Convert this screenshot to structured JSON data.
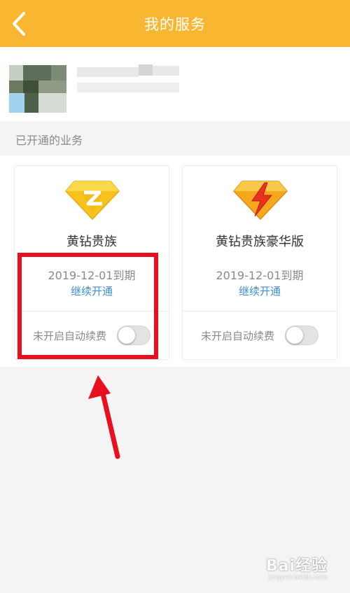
{
  "header": {
    "title": "我的服务"
  },
  "section": {
    "label": "已开通的业务"
  },
  "cards": [
    {
      "name": "黄钻贵族",
      "expiry": "2019-12-01到期",
      "renew_label": "继续开通",
      "auto_renew_label": "未开启自动续费",
      "auto_renew_on": false,
      "icon": "yellow-diamond-icon"
    },
    {
      "name": "黄钻贵族豪华版",
      "expiry": "2019-12-01到期",
      "renew_label": "继续开通",
      "auto_renew_label": "未开启自动续费",
      "auto_renew_on": false,
      "icon": "deluxe-diamond-icon"
    }
  ],
  "watermark": {
    "brand": "Bai经验",
    "url": "jingyan.baidu.com"
  },
  "colors": {
    "header": "#f9b731",
    "link": "#3f8fd1",
    "highlight": "#e8101f"
  }
}
